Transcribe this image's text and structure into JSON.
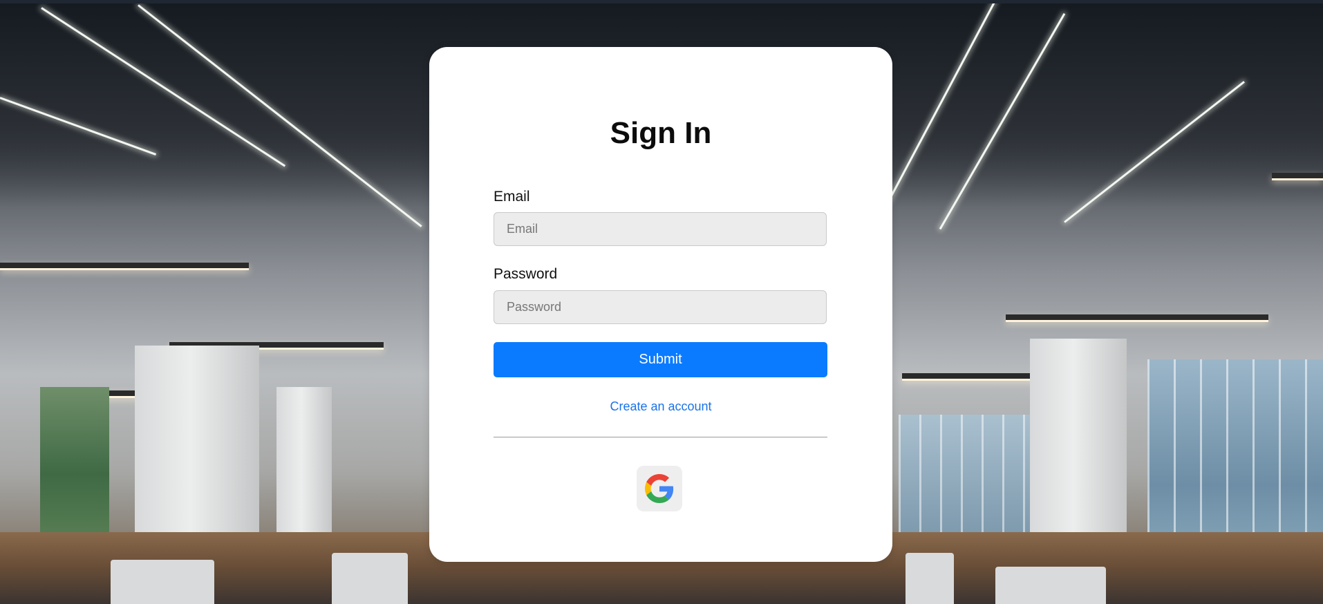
{
  "signin": {
    "title": "Sign In",
    "email": {
      "label": "Email",
      "placeholder": "Email",
      "value": ""
    },
    "password": {
      "label": "Password",
      "placeholder": "Password",
      "value": ""
    },
    "submit_label": "Submit",
    "create_account_label": "Create an account",
    "google_icon": "google-icon"
  },
  "colors": {
    "accent": "#0a7bff",
    "link": "#1a73e8",
    "card": "#ffffff",
    "input_bg": "#ececec"
  }
}
